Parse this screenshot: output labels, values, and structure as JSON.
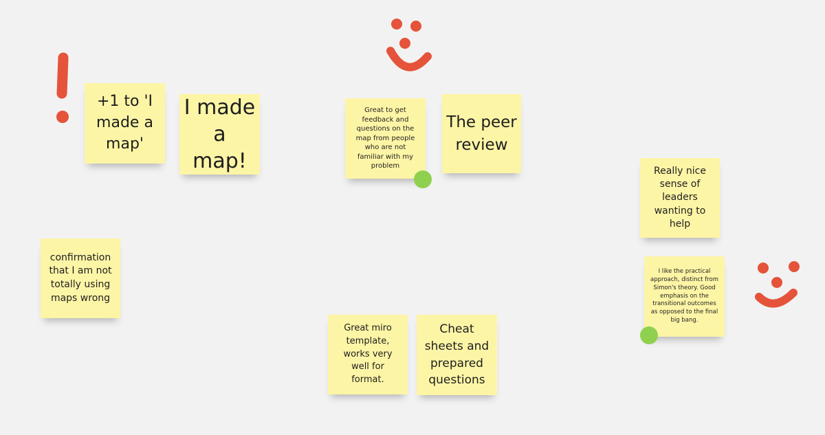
{
  "board": {
    "background_color": "#f2f2f2",
    "sticky_color": "#fdf5a6",
    "accent_red": "#e4533a",
    "dot_green": "#8fd14f"
  },
  "stickies": {
    "plus_one_map": "+1 to 'I made a map'",
    "made_a_map": "I made a map!",
    "feedback": "Great to get feedback and questions on the map  from people who are not familiar with my problem",
    "peer_review": "The peer review",
    "leaders": "Really nice sense of leaders wanting to help",
    "confirmation": "confirmation that I am not totally using maps wrong",
    "practical": "I like the practical approach, distinct from Simon's theory.  Good emphasis on the transitional outcomes as opposed to the final big bang.",
    "miro_template": "Great miro template, works very well for format.",
    "cheat_sheets": "Cheat sheets and prepared questions"
  },
  "icons": {
    "exclamation": "exclamation-drawing",
    "smiley_top": "smiley-face-drawing",
    "smiley_right": "smiley-face-drawing",
    "vote_dot": "green-vote-dot"
  }
}
